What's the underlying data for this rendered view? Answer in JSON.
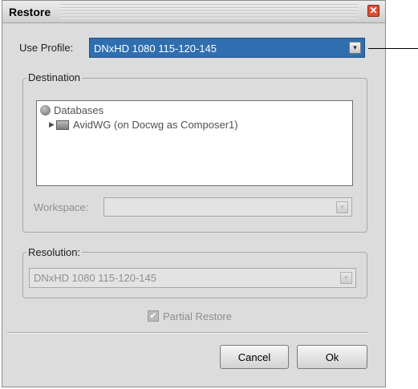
{
  "dialog": {
    "title": "Restore",
    "close_icon": "close-icon"
  },
  "profile": {
    "label": "Use Profile:",
    "value": "DNxHD 1080 115-120-145"
  },
  "destination": {
    "legend": "Destination",
    "tree": {
      "root": {
        "label": "Databases",
        "icon": "globe-icon"
      },
      "child": {
        "label": "AvidWG (on Docwg as Composer1)",
        "icon": "database-icon"
      }
    },
    "workspace": {
      "label": "Workspace:",
      "value": ""
    }
  },
  "resolution": {
    "legend": "Resolution:",
    "value": "DNxHD 1080 115-120-145"
  },
  "options": {
    "partial_restore_label": "Partial Restore",
    "partial_restore_checked": true
  },
  "buttons": {
    "cancel": "Cancel",
    "ok": "Ok"
  },
  "colors": {
    "selection": "#2f6fb0",
    "dialog_bg": "#dcdcdc",
    "close": "#d94f33"
  }
}
